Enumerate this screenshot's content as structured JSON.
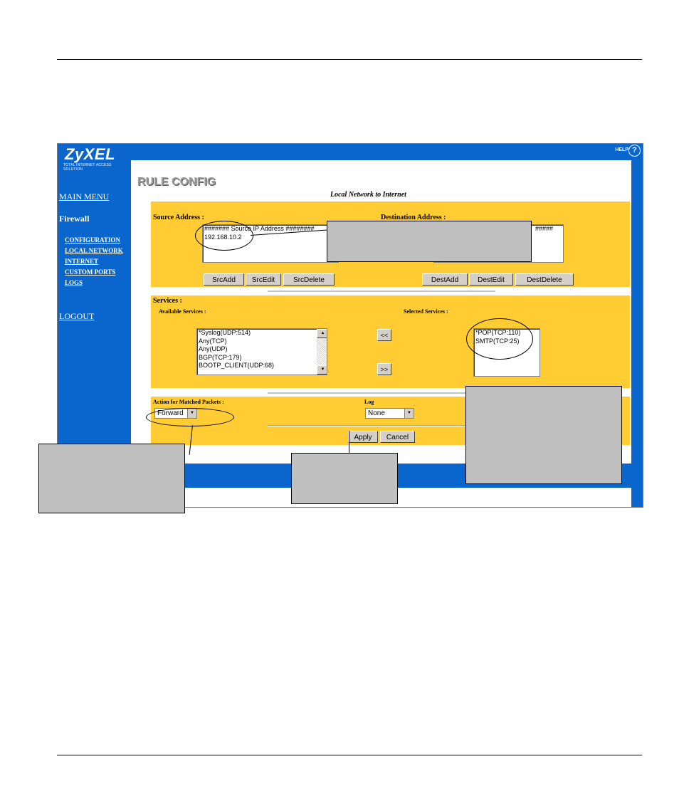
{
  "header": {
    "logo": "ZyXEL",
    "logo_tagline": "TOTAL INTERNET ACCESS SOLUTION",
    "help": "HELP",
    "help_icon": "?"
  },
  "sidebar": {
    "main_menu": "MAIN MENU",
    "section": "Firewall",
    "items": [
      "CONFIGURATION",
      "LOCAL NETWORK",
      "INTERNET",
      "CUSTOM PORTS",
      "LOGS"
    ],
    "logout": "LOGOUT"
  },
  "page": {
    "title": "RULE CONFIG",
    "subtitle": "Local Network to Internet"
  },
  "address": {
    "source_label": "Source Address :",
    "destination_label": "Destination Address :",
    "source_list": [
      "####### Source IP Address ########",
      "192.168.10.2"
    ],
    "destination_list_fragment": "#####",
    "src_buttons": [
      "SrcAdd",
      "SrcEdit",
      "SrcDelete"
    ],
    "dest_buttons": [
      "DestAdd",
      "DestEdit",
      "DestDelete"
    ]
  },
  "services": {
    "label": "Services :",
    "available_label": "Available Services :",
    "selected_label": "Selected Services :",
    "available": [
      "*Syslog(UDP:514)",
      "Any(TCP)",
      "Any(UDP)",
      "BGP(TCP:179)",
      "BOOTP_CLIENT(UDP:68)"
    ],
    "selected": [
      "*POP(TCP:110)",
      "SMTP(TCP:25)"
    ],
    "add_button": "<<",
    "remove_button": ">>"
  },
  "action": {
    "label": "Action for Matched Packets :",
    "value": "Forward",
    "log_label": "Log",
    "log_value": "None",
    "apply": "Apply",
    "cancel": "Cancel"
  },
  "colors": {
    "nav_blue": "#0a66cc",
    "panel_yellow": "#ffcc33",
    "callout_gray": "#c0c0c0"
  }
}
